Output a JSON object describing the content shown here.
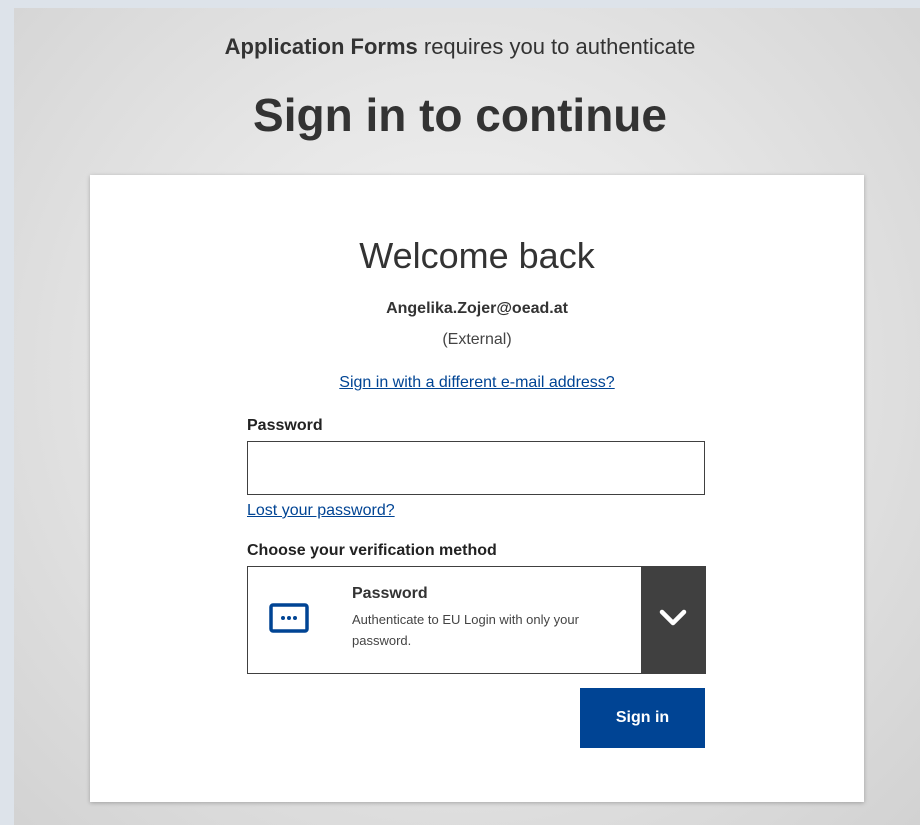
{
  "header": {
    "app_name": "Application Forms",
    "requires_text": " requires you to authenticate",
    "headline": "Sign in to continue"
  },
  "card": {
    "welcome": "Welcome back",
    "email": "Angelika.Zojer@oead.at",
    "account_type": "(External)",
    "different_email_link": "Sign in with a different e-mail address?",
    "password_label": "Password",
    "password_value": "",
    "lost_password_link": "Lost your password?",
    "verification_label": "Choose your verification method",
    "verification": {
      "selected_title": "Password",
      "selected_description": "Authenticate to EU Login with only your password.",
      "icon": "password-dots-icon"
    },
    "signin_button": "Sign in"
  },
  "colors": {
    "link": "#004494",
    "primary_button": "#004494",
    "chevron_bg": "#404040"
  }
}
